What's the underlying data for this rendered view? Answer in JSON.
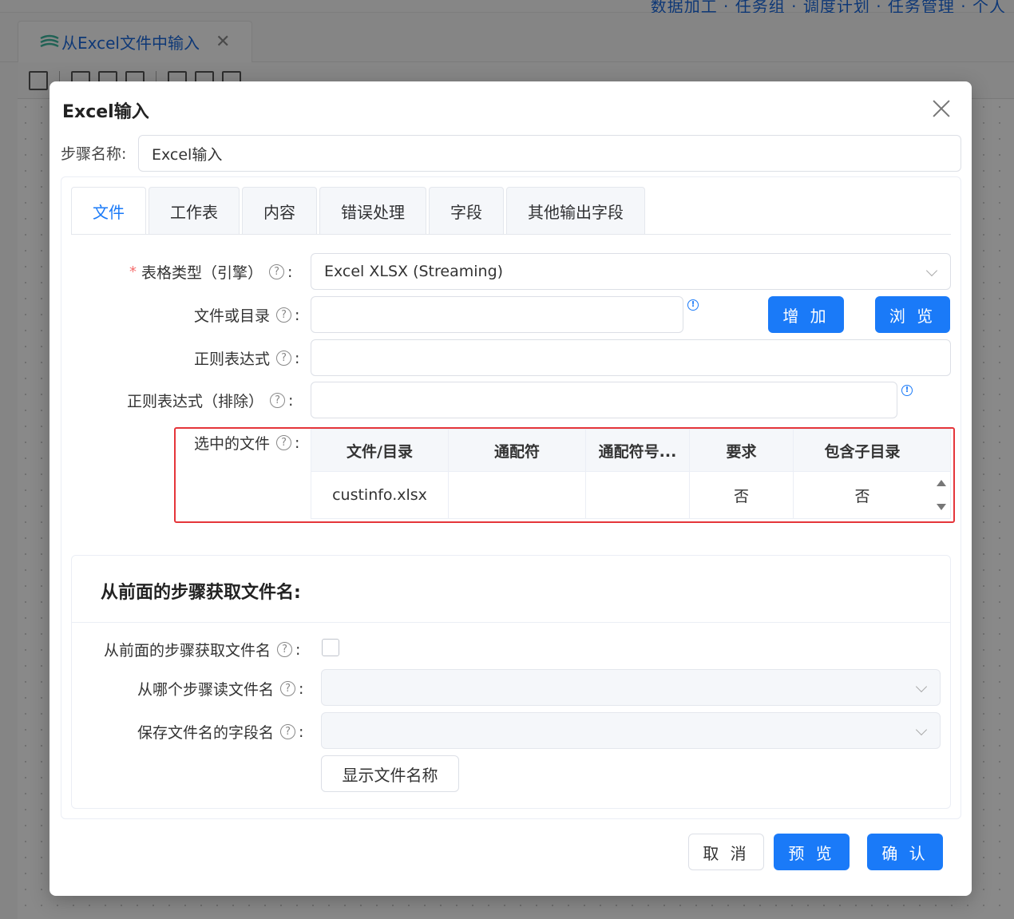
{
  "background": {
    "nav_text": "数据加工 · 任务组 · 调度计划 · 任务管理 · 个人",
    "tab_title": "从Excel文件中输入",
    "tab_icon": "layers-icon",
    "tab_close_icon": "close-icon"
  },
  "dialog": {
    "title": "Excel输入",
    "step_name_label": "步骤名称:",
    "step_name_value": "Excel输入",
    "tabs": [
      {
        "label": "文件",
        "active": true
      },
      {
        "label": "工作表"
      },
      {
        "label": "内容"
      },
      {
        "label": "错误处理"
      },
      {
        "label": "字段"
      },
      {
        "label": "其他输出字段"
      }
    ],
    "fields": {
      "table_type_label": "表格类型（引擎）",
      "table_type_value": "Excel XLSX (Streaming)",
      "file_or_dir_label": "文件或目录",
      "file_or_dir_value": "",
      "add_button": "增 加",
      "browse_button": "浏 览",
      "regex_label": "正则表达式",
      "regex_value": "",
      "regex_exclude_label": "正则表达式（排除）",
      "regex_exclude_value": "",
      "selected_files_label": "选中的文件"
    },
    "selected_files_table": {
      "headers": [
        "文件/目录",
        "通配符",
        "通配符号...",
        "要求",
        "包含子目录"
      ],
      "rows": [
        [
          "custinfo.xlsx",
          "",
          "",
          "否",
          "否"
        ]
      ]
    },
    "prev_step_section": {
      "title": "从前面的步骤获取文件名:",
      "accept_label": "从前面的步骤获取文件名",
      "accept_checked": false,
      "step_read_label": "从哪个步骤读文件名",
      "step_read_value": "",
      "field_name_label": "保存文件名的字段名",
      "field_name_value": "",
      "show_filenames_button": "显示文件名称"
    },
    "footer": {
      "cancel": "取 消",
      "preview": "预 览",
      "ok": "确 认"
    },
    "colors": {
      "primary": "#1a7af8",
      "highlight": "#e5353a",
      "required": "#f56c6c"
    }
  }
}
